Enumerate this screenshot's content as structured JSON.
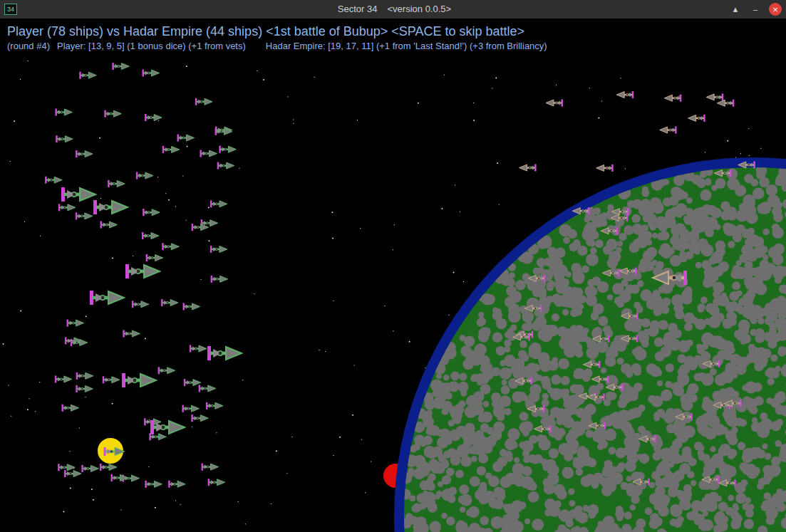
{
  "window": {
    "app_icon": "34",
    "title": "Sector 34",
    "version": "<version 0.0.5>",
    "controls": [
      {
        "glyph": "▲",
        "kind": "plain"
      },
      {
        "glyph": "–",
        "kind": "plain"
      },
      {
        "glyph": "×",
        "kind": "close"
      }
    ]
  },
  "battle": {
    "headline": "Player (78 ships) vs Hadar Empire (44 ships) <1st battle of Bubup> <SPACE to skip battle>",
    "round": "(round #4)",
    "player_stats": "Player: [13, 9, 5] (1 bonus dice) (+1 from vets)",
    "enemy_stats": "Hadar Empire: [19, 17, 11] (+1 from 'Last Stand!') (+3 from Brilliancy)"
  },
  "fleets": [
    {
      "side": "player",
      "facing": "right",
      "color": "#5fae6a"
    },
    {
      "side": "enemy",
      "facing": "left",
      "color": "#c9a98a"
    }
  ]
}
